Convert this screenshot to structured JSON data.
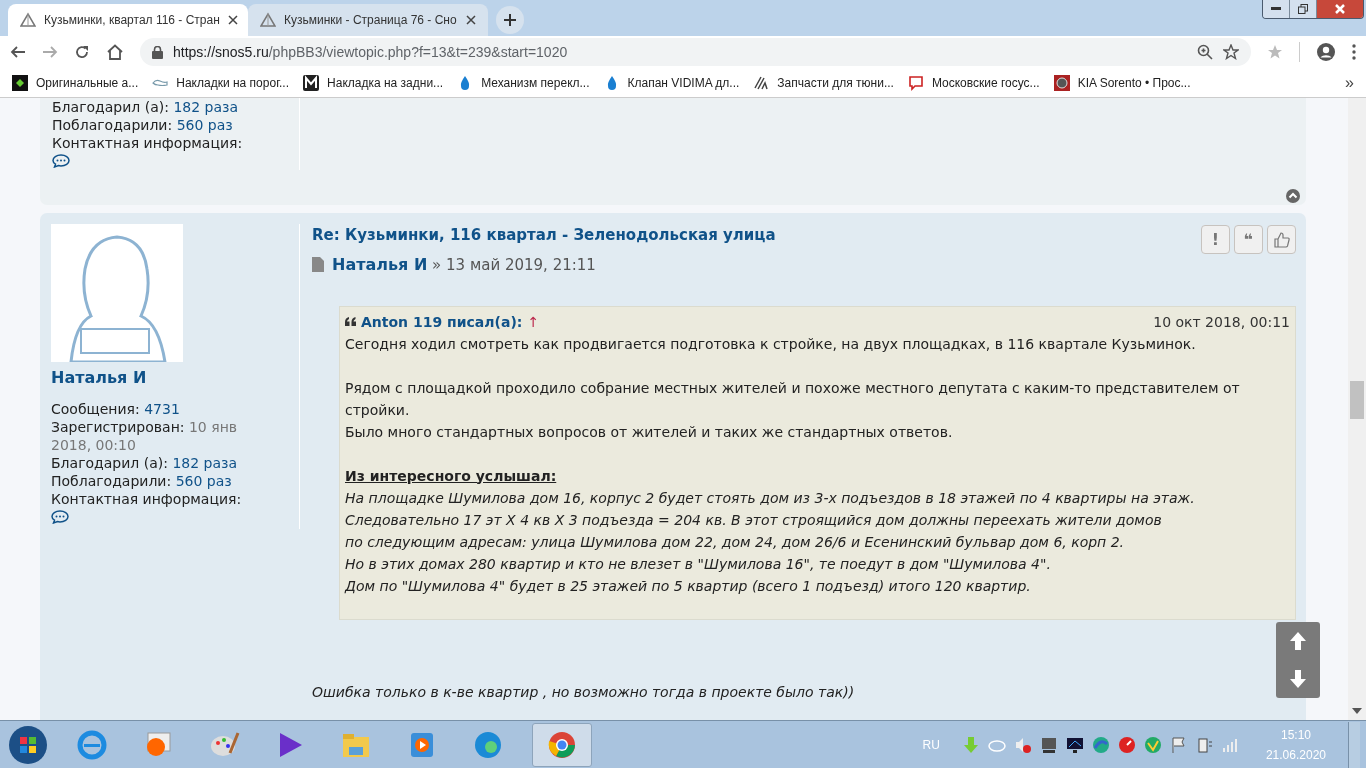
{
  "browser": {
    "tabs": [
      {
        "title": "Кузьминки, квартал 116 - Стран",
        "selected": true
      },
      {
        "title": "Кузьминки - Страница 76 - Сно",
        "selected": false
      }
    ],
    "url_host": "https://snos5.ru",
    "url_path": "/phpBB3/viewtopic.php?f=13&t=239&start=1020",
    "bookmarks": [
      "Оригинальные  а...",
      "Накладки на порог...",
      "Накладка на задни...",
      "Механизм перекл...",
      "Клапан VIDIMA дл...",
      "Запчасти для тюни...",
      "Московские госус...",
      "KIA Sorento • Прос..."
    ],
    "bookmarks_more": "»"
  },
  "previous_post": {
    "profile": [
      {
        "label": "Благодарил (а):",
        "value": "182 раза"
      },
      {
        "label": "Поблагодарили:",
        "value": "560 раз"
      }
    ],
    "contact_label": "Контактная информация:"
  },
  "post": {
    "title": "Re: Кузьминки, 116 квартал - Зеленодольская улица",
    "author": "Наталья И",
    "separator": "»",
    "date": "13 май 2019, 21:11",
    "profile_name": "Наталья И",
    "profile": [
      {
        "label": "Сообщения:",
        "value": "4731",
        "kind": "link"
      },
      {
        "label": "Зарегистрирован:",
        "value": "10 янв 2018, 00:10",
        "kind": "muted"
      },
      {
        "label": "Благодарил (а):",
        "value": "182 раза",
        "kind": "link"
      },
      {
        "label": "Поблагодарили:",
        "value": "560 раз",
        "kind": "link"
      }
    ],
    "contact_label": "Контактная информация:",
    "actions": [
      "!",
      "❝"
    ],
    "quote": {
      "author": "Anton 119 писал(а):",
      "arrow": "↑",
      "date": "10 окт 2018, 00:11",
      "lines": [
        {
          "kind": "text",
          "text": "Сегодня ходил смотреть как продвигается подготовка к стройке, на двух площадках, в 116 квартале Кузьминок."
        },
        {
          "kind": "gap"
        },
        {
          "kind": "text",
          "text": "Рядом с площадкой проходило собрание местных жителей и похоже местного депутата с каким-то представителем от стройки."
        },
        {
          "kind": "text",
          "text": "Было много стандартных вопросов от жителей и таких же стандартных ответов."
        },
        {
          "kind": "gap"
        },
        {
          "kind": "heading",
          "text": "Из интересного услышал:"
        },
        {
          "kind": "italic",
          "text": "На площадке Шумилова дом 16, корпус 2 будет стоять дом из 3-х подъездов в 18 этажей по 4 квартиры на этаж."
        },
        {
          "kind": "italic",
          "text": "Следовательно 17 эт Х 4 кв Х 3 подъезда = 204 кв. В этот строящийся дом должны переехать жители домов"
        },
        {
          "kind": "italic",
          "text": "по следующим адресам: улица Шумилова дом 22, дом 24, дом 26/6 и Есенинский бульвар дом 6, корп 2."
        },
        {
          "kind": "italic",
          "text": "Но в этих домах 280 квартир и кто не влезет в \"Шумилова 16\", те поедут в дом \"Шумилова 4\"."
        },
        {
          "kind": "italic",
          "text": "Дом по \"Шумилова 4\" будет в 25 этажей по 5 квартир (всего 1 подъезд) итого 120 квартир."
        }
      ]
    },
    "body": "Ошибка только в к-ве квартир , но возможно тогда в проекте было так))"
  },
  "taskbar": {
    "language": "RU",
    "time": "15:10",
    "date": "21.06.2020"
  }
}
